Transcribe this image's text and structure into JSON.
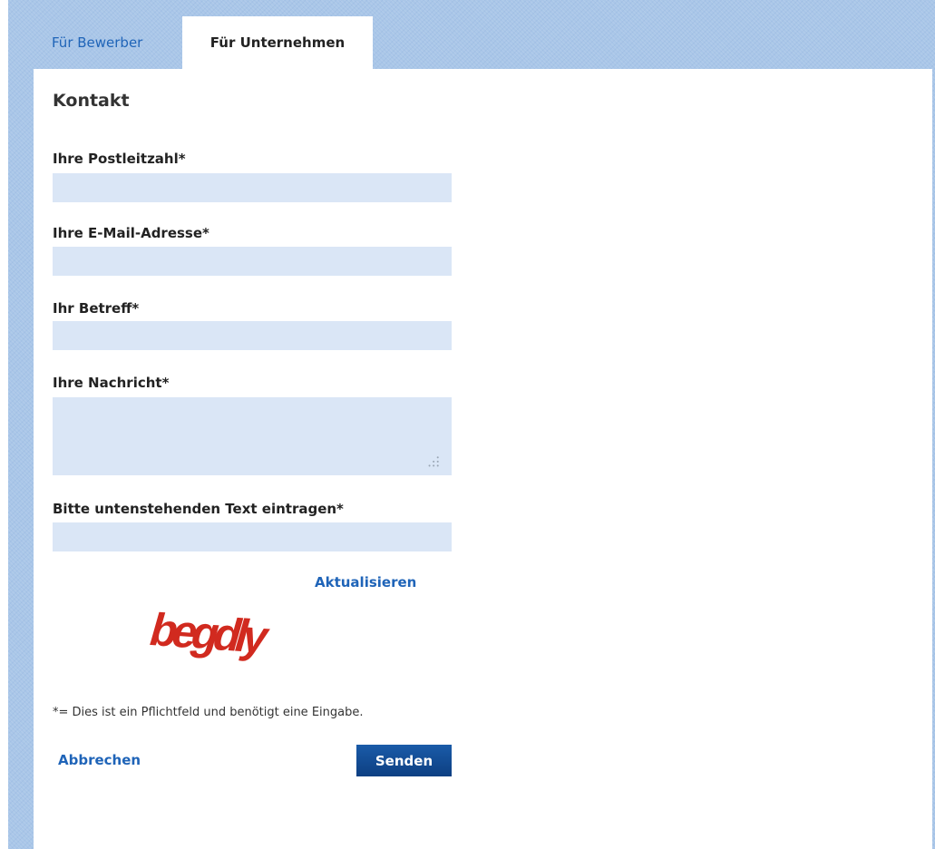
{
  "tabs": [
    {
      "label": "Für Bewerber",
      "active": false
    },
    {
      "label": "Für Unternehmen",
      "active": true
    }
  ],
  "form": {
    "title": "Kontakt",
    "fields": [
      {
        "label": "Ihre Postleitzahl*",
        "value": "",
        "placeholder": ""
      },
      {
        "label": "Ihre E-Mail-Adresse*",
        "value": "",
        "placeholder": ""
      },
      {
        "label": "Ihr Betreff*",
        "value": "",
        "placeholder": ""
      },
      {
        "label": "Ihre Nachricht*",
        "value": "",
        "placeholder": ""
      },
      {
        "label": "Bitte untenstehenden Text eintragen*",
        "value": "",
        "placeholder": ""
      }
    ],
    "refresh_label": "Aktualisieren",
    "captcha_text": "begdly",
    "required_note": "*= Dies ist ein Pflichtfeld und benötigt eine Eingabe.",
    "cancel_label": "Abbrechen",
    "submit_label": "Senden"
  },
  "colors": {
    "accent": "#1f64b8",
    "input_bg": "#dae6f6",
    "button_bg": "#0d3f82",
    "captcha": "#d12a1f",
    "background": "#a9c6e8"
  }
}
